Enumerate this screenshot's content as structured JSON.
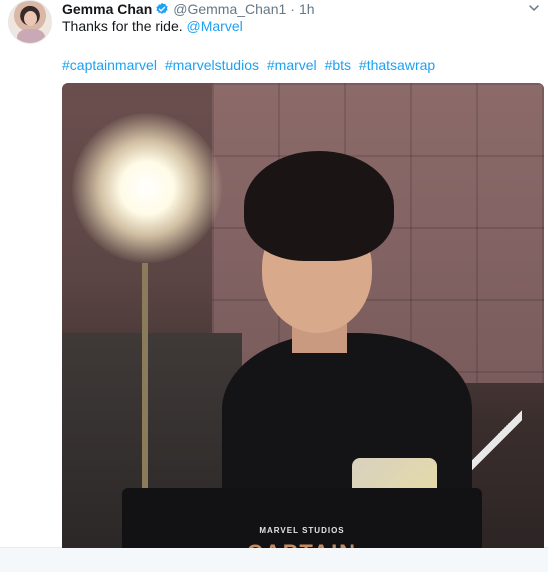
{
  "tweet": {
    "author_name": "Gemma Chan",
    "handle": "@Gemma_Chan1",
    "separator": "·",
    "time": "1h",
    "text_prefix": "Thanks for the ride. ",
    "mention": "@Marvel",
    "hashtags": [
      "#captainmarvel",
      "#marvelstudios",
      "#marvel",
      "#bts",
      "#thatsawrap"
    ]
  },
  "photo": {
    "chair_logo": "MARVEL STUDIOS",
    "chair_title": "CAPTAIN"
  },
  "icons": {
    "verified": "verified-badge-icon",
    "caret": "chevron-down-icon"
  },
  "colors": {
    "link": "#1da1f2",
    "muted": "#657786",
    "text": "#14171a"
  }
}
